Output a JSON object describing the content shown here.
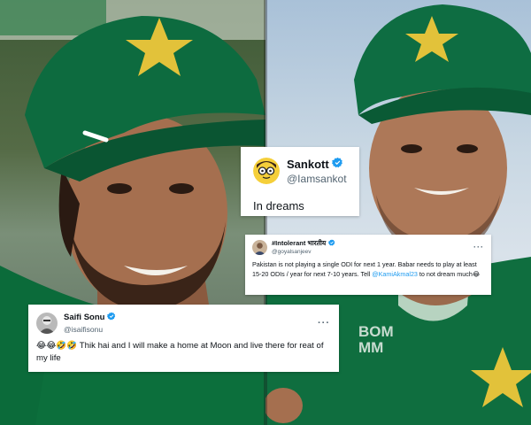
{
  "colors": {
    "verified": "#1d9bf0",
    "link": "#1d9bf0",
    "jersey": "#0b6b3a",
    "cap": "#0d6b3f",
    "star": "#e2c23a"
  },
  "tweets": [
    {
      "name": "Sankott",
      "handle": "@Iamsankot",
      "avatar_icon": "cartoon-glasses-avatar-icon",
      "text": "In dreams"
    },
    {
      "name": "#Intolerant भारतीय",
      "handle": "@goyalsanjeev",
      "avatar_icon": "profile-photo-avatar-icon",
      "more": "···",
      "text_before_link": "Pakistan is not playing a single ODI for next 1 year.  Babar needs to play at least 15-20 ODIs / year for next 7-10 years. Tell ",
      "link": "@KamiAkmal23",
      "text_after_link": " to not dream much",
      "emoji": "😂"
    },
    {
      "name": "Saifi Sonu",
      "handle": "@isaifisonu",
      "avatar_icon": "profile-photo-avatar-icon",
      "more": "···",
      "emojis": "😂😂🤣🤣",
      "text": " Thik hai and I will make a home at Moon and live there for reat of my life"
    }
  ],
  "jersey_text": "BOM\nMM"
}
